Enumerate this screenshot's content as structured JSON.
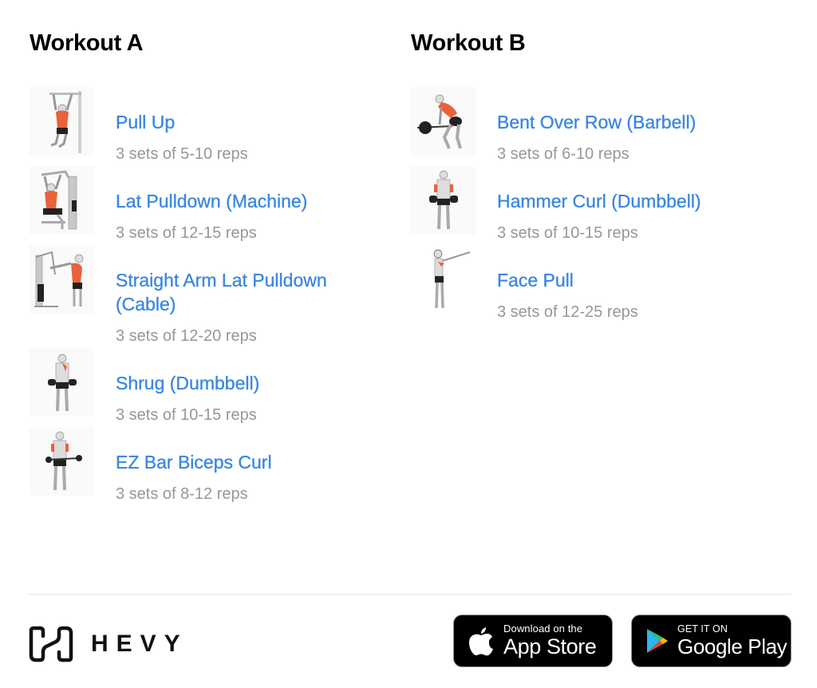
{
  "workouts": [
    {
      "title": "Workout A",
      "exercises": [
        {
          "name": "Pull Up",
          "sets": "3 sets of 5-10 reps",
          "image": "pull-up-illustration"
        },
        {
          "name": "Lat Pulldown (Machine)",
          "sets": "3 sets of 12-15 reps",
          "image": "lat-pulldown-illustration"
        },
        {
          "name": "Straight Arm Lat Pulldown (Cable)",
          "sets": "3 sets of 12-20 reps",
          "image": "straight-arm-pulldown-illustration"
        },
        {
          "name": "Shrug (Dumbbell)",
          "sets": "3 sets of 10-15 reps",
          "image": "dumbbell-shrug-illustration"
        },
        {
          "name": "EZ Bar Biceps Curl",
          "sets": "3 sets of 8-12 reps",
          "image": "ez-bar-curl-illustration"
        }
      ]
    },
    {
      "title": "Workout B",
      "exercises": [
        {
          "name": "Bent Over Row (Barbell)",
          "sets": "3 sets of 6-10 reps",
          "image": "barbell-row-illustration"
        },
        {
          "name": "Hammer Curl (Dumbbell)",
          "sets": "3 sets of 10-15 reps",
          "image": "hammer-curl-illustration"
        },
        {
          "name": "Face Pull",
          "sets": "3 sets of 12-25 reps",
          "image": "face-pull-illustration"
        }
      ]
    }
  ],
  "footer": {
    "brand": "HEVY",
    "app_store": {
      "small": "Download on the",
      "large": "App Store",
      "icon": "apple-icon"
    },
    "google_play": {
      "small": "GET IT ON",
      "large": "Google Play",
      "icon": "google-play-icon"
    }
  },
  "colors": {
    "link_blue": "#3b87e4",
    "muted_gray": "#979797",
    "muscle_highlight": "#e8633a"
  }
}
